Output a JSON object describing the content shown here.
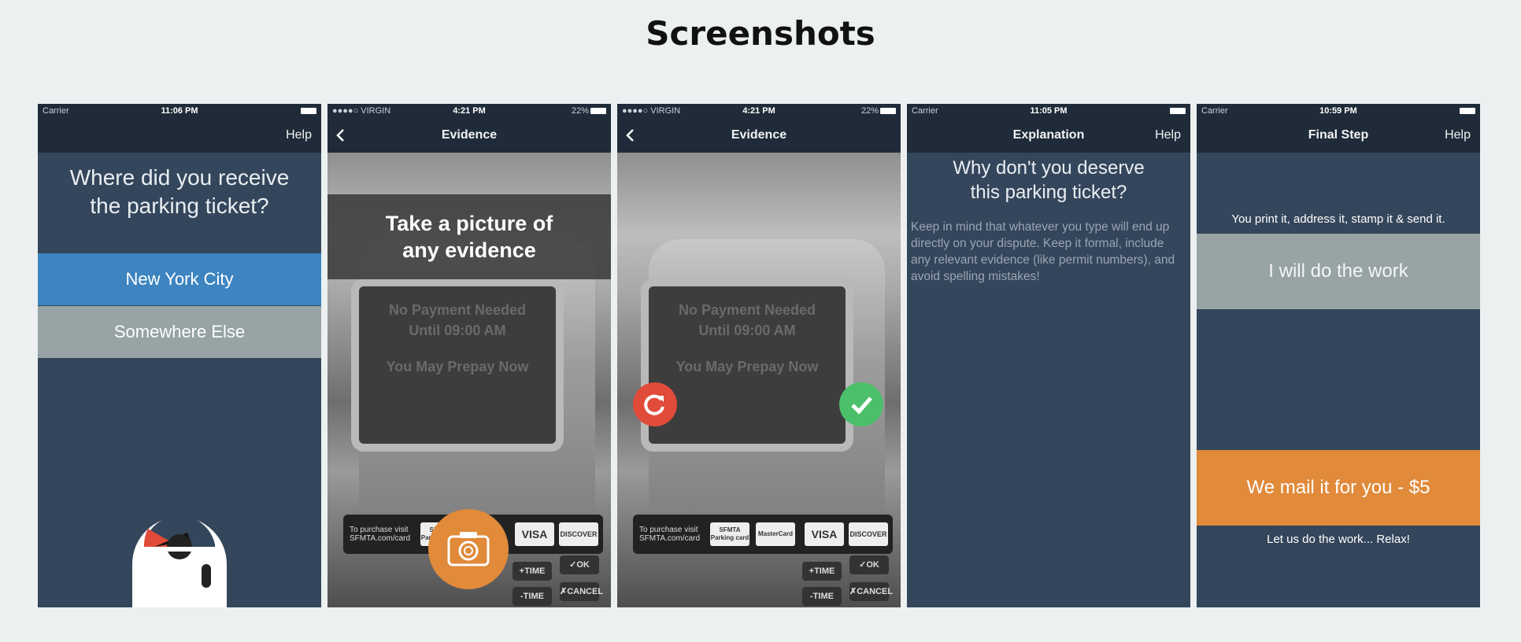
{
  "page": {
    "title": "Screenshots"
  },
  "colors": {
    "page_bg": "#ecf0f1",
    "screen_bg": "#34465b",
    "navbar_bg": "#1f2b38",
    "blue": "#3d84c0",
    "grey": "#97a3a4",
    "orange": "#e08a3a",
    "red": "#e04b3a",
    "green": "#4cbf6a"
  },
  "phones": [
    {
      "status": {
        "carrier": "Carrier",
        "time": "11:06 PM"
      },
      "nav": {
        "title": "",
        "right": "Help"
      },
      "question": [
        "Where did you receive",
        "the parking ticket?"
      ],
      "options": [
        "New York City",
        "Somewhere Else"
      ]
    },
    {
      "status": {
        "carrier": "●●●●○ VIRGIN",
        "time": "4:21 PM",
        "battery": "22%"
      },
      "nav": {
        "title": "Evidence",
        "back_icon": "chevron-left-icon"
      },
      "overlay": [
        "Take a picture of",
        "any evidence"
      ],
      "photo": {
        "screen_lines": [
          "No Payment Needed",
          "Until 09:00 AM",
          "You May Prepay Now"
        ],
        "card_label": [
          "To purchase visit",
          "SFMTA.com/card"
        ],
        "cards": [
          "SFMTA Parking card",
          "VISA",
          "DISCOVER"
        ],
        "keys": [
          "+TIME",
          "✓OK",
          "-TIME",
          "✗CANCEL"
        ]
      },
      "action_icon": "camera-icon"
    },
    {
      "status": {
        "carrier": "●●●●○ VIRGIN",
        "time": "4:21 PM",
        "battery": "22%"
      },
      "nav": {
        "title": "Evidence",
        "back_icon": "chevron-left-icon"
      },
      "photo": {
        "screen_lines": [
          "No Payment Needed",
          "Until 09:00 AM",
          "You May Prepay Now"
        ],
        "card_label": [
          "To purchase visit",
          "SFMTA.com/card"
        ],
        "cards": [
          "SFMTA Parking card",
          "MasterCard",
          "VISA",
          "DISCOVER"
        ],
        "keys": [
          "+TIME",
          "✓OK",
          "-TIME",
          "✗CANCEL"
        ]
      },
      "actions": [
        "retake-icon",
        "confirm-check-icon"
      ]
    },
    {
      "status": {
        "carrier": "Carrier",
        "time": "11:05 PM"
      },
      "nav": {
        "title": "Explanation",
        "right": "Help"
      },
      "question": [
        "Why don't you deserve",
        "this parking ticket?"
      ],
      "body": "Keep in mind that whatever you type will end up directly on your dispute. Keep it formal, include any relevant evidence (like permit numbers), and avoid spelling mistakes!"
    },
    {
      "status": {
        "carrier": "Carrier",
        "time": "10:59 PM"
      },
      "nav": {
        "title": "Final Step",
        "right": "Help"
      },
      "intro": "You print it, address it, stamp it & send it.",
      "options": [
        "I will do the work",
        "We mail it for you - $5"
      ],
      "footer": "Let us do the work... Relax!"
    }
  ]
}
